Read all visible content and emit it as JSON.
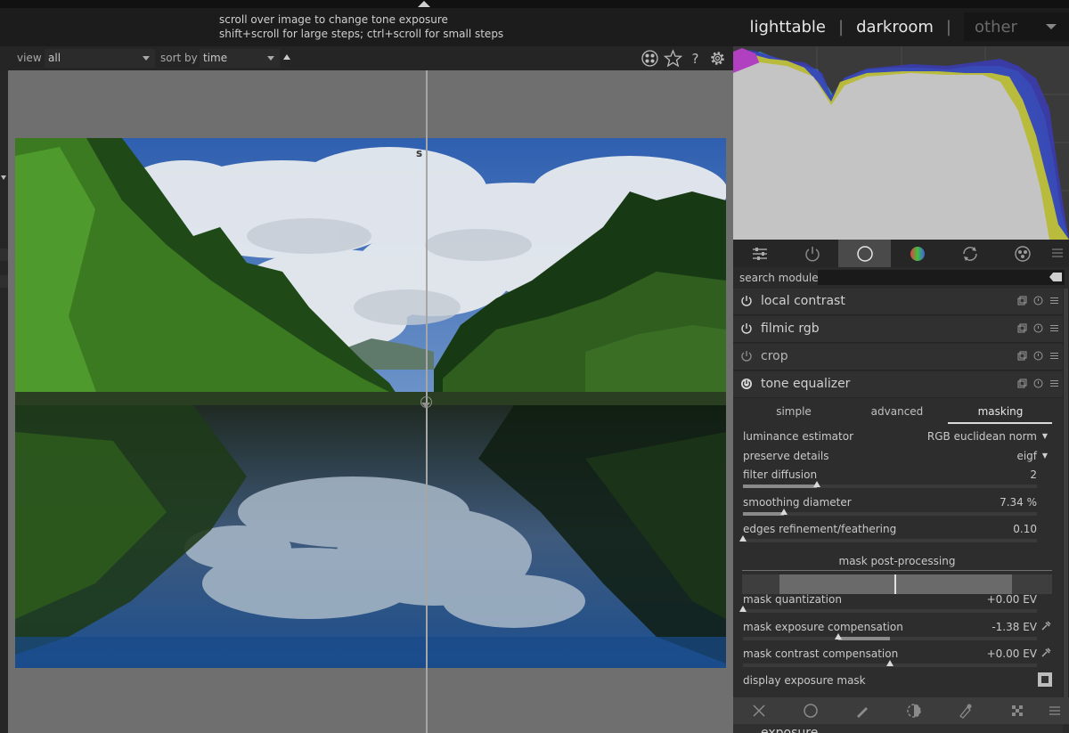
{
  "hint": {
    "line1": "scroll over image to change tone exposure",
    "line2": "shift+scroll for large steps; ctrl+scroll for small steps"
  },
  "views": {
    "lighttable": "lighttable",
    "darkroom": "darkroom",
    "other": "other",
    "separator": "|"
  },
  "toolbar": {
    "view_label": "view",
    "view_value": "all",
    "sort_label": "sort by",
    "sort_value": "time",
    "icons": [
      "grouping-icon",
      "star-icon",
      "help-icon",
      "gear-icon"
    ]
  },
  "image": {
    "overlay_letter": "s"
  },
  "module_tabs": [
    {
      "name": "quick-access-icon"
    },
    {
      "name": "power-icon"
    },
    {
      "name": "circle-icon",
      "active": true
    },
    {
      "name": "color-wheel-icon"
    },
    {
      "name": "correct-icon"
    },
    {
      "name": "effect-icon"
    }
  ],
  "search": {
    "label": "search module"
  },
  "modules": [
    {
      "name": "local contrast",
      "enabled": true
    },
    {
      "name": "filmic rgb",
      "enabled": true
    },
    {
      "name": "crop",
      "enabled": false
    },
    {
      "name": "tone equalizer",
      "enabled": true
    }
  ],
  "tone_equalizer": {
    "tabs": [
      "simple",
      "advanced",
      "masking"
    ],
    "active_tab": "masking",
    "params": {
      "luminance_estimator": {
        "label": "luminance estimator",
        "value": "RGB euclidean norm"
      },
      "preserve_details": {
        "label": "preserve details",
        "value": "eigf"
      },
      "filter_diffusion": {
        "label": "filter diffusion",
        "value": "2",
        "level": 0.25
      },
      "smoothing_diameter": {
        "label": "smoothing diameter",
        "value": "7.34 %",
        "level": 0.14
      },
      "edges_refinement": {
        "label": "edges refinement/feathering",
        "value": "0.10",
        "level": 0.0
      },
      "mask_quantization": {
        "label": "mask quantization",
        "value": "+0.00 EV",
        "level": 0.0
      },
      "mask_exposure_comp": {
        "label": "mask exposure compensation",
        "value": "-1.38 EV",
        "level": -0.35
      },
      "mask_contrast_comp": {
        "label": "mask contrast compensation",
        "value": "+0.00 EV",
        "level": 0.0
      }
    },
    "section_title": "mask post-processing",
    "display_mask_label": "display exposure mask"
  },
  "next_module": {
    "name": "exposure"
  },
  "colors": {
    "accent": "#d9d9d9",
    "panel": "#2a2a2a",
    "histogram_bg": "#3a3a3a"
  }
}
